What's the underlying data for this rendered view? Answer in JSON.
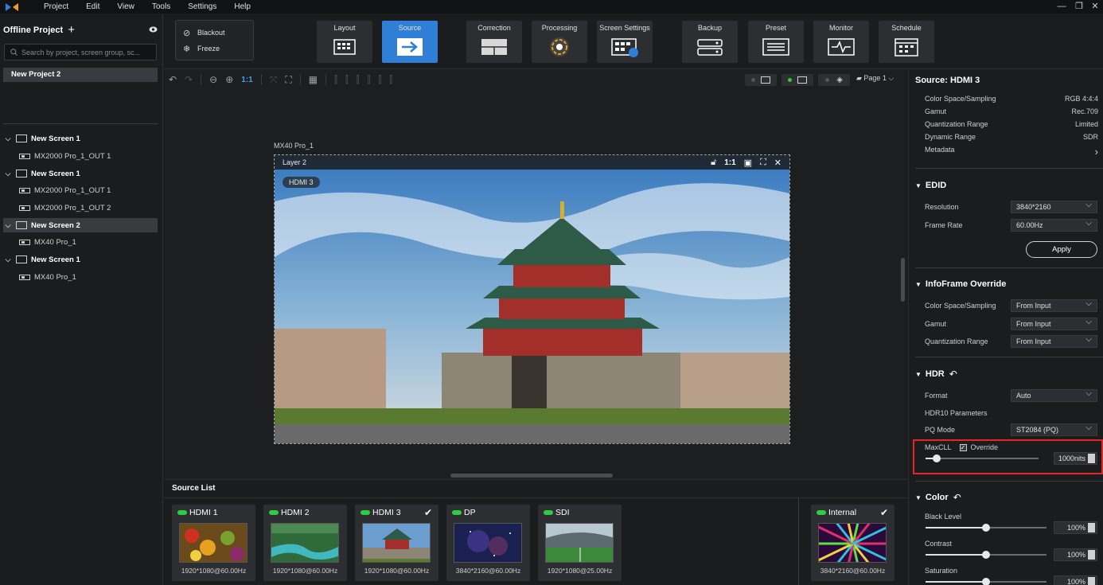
{
  "menubar": {
    "items": [
      "Project",
      "Edit",
      "View",
      "Tools",
      "Settings",
      "Help"
    ],
    "window_controls": [
      "—",
      "❐",
      "✕"
    ]
  },
  "left_panel": {
    "project_title": "Offline Project",
    "search_placeholder": "Search by project, screen group, sc...",
    "project_item": "New Project 2",
    "tree": [
      {
        "label": "New Screen 1",
        "type": "screen",
        "selected": false
      },
      {
        "label": "MX2000 Pro_1_OUT 1",
        "type": "device"
      },
      {
        "label": "New Screen 1",
        "type": "screen",
        "selected": false
      },
      {
        "label": "MX2000 Pro_1_OUT 1",
        "type": "device"
      },
      {
        "label": "MX2000 Pro_1_OUT 2",
        "type": "device"
      },
      {
        "label": "New Screen 2",
        "type": "screen",
        "selected": true
      },
      {
        "label": "MX40 Pro_1",
        "type": "device"
      },
      {
        "label": "New Screen 1",
        "type": "screen",
        "selected": false
      },
      {
        "label": "MX40 Pro_1",
        "type": "device"
      }
    ]
  },
  "toolbar": {
    "blackout": "Blackout",
    "freeze": "Freeze",
    "buttons": [
      "Layout",
      "Source",
      "Correction",
      "Processing",
      "Screen Settings",
      "Backup",
      "Preset",
      "Monitor",
      "Schedule"
    ],
    "active": "Source"
  },
  "canvas": {
    "zoom_label": "1:1",
    "page_label": "Page 1",
    "device_label": "MX40 Pro_1",
    "layer_label": "Layer 2",
    "layer_ratio": "1:1",
    "source_tag": "HDMI 3"
  },
  "source_list": {
    "title": "Source List",
    "sources": [
      {
        "name": "HDMI 1",
        "res": "1920*1080@60.00Hz",
        "checked": false
      },
      {
        "name": "HDMI 2",
        "res": "1920*1080@60.00Hz",
        "checked": false
      },
      {
        "name": "HDMI 3",
        "res": "1920*1080@60.00Hz",
        "checked": true
      },
      {
        "name": "DP",
        "res": "3840*2160@60.00Hz",
        "checked": false
      },
      {
        "name": "SDI",
        "res": "1920*1080@25.00Hz",
        "checked": false
      }
    ],
    "internal": {
      "name": "Internal",
      "res": "3840*2160@60.00Hz",
      "checked": true
    }
  },
  "right_panel": {
    "title": "Source: HDMI 3",
    "info": [
      {
        "k": "Color Space/Sampling",
        "v": "RGB 4:4:4"
      },
      {
        "k": "Gamut",
        "v": "Rec.709"
      },
      {
        "k": "Quantization Range",
        "v": "Limited"
      },
      {
        "k": "Dynamic Range",
        "v": "SDR"
      },
      {
        "k": "Metadata",
        "v": "›"
      }
    ],
    "edid": {
      "title": "EDID",
      "resolution_label": "Resolution",
      "resolution": "3840*2160",
      "frame_rate_label": "Frame Rate",
      "frame_rate": "60.00Hz",
      "apply": "Apply"
    },
    "infoframe": {
      "title": "InfoFrame Override",
      "rows": [
        {
          "k": "Color Space/Sampling",
          "v": "From Input"
        },
        {
          "k": "Gamut",
          "v": "From Input"
        },
        {
          "k": "Quantization Range",
          "v": "From Input"
        }
      ]
    },
    "hdr": {
      "title": "HDR",
      "format_label": "Format",
      "format": "Auto",
      "params_label": "HDR10 Parameters",
      "pq_label": "PQ Mode",
      "pq": "ST2084 (PQ)",
      "maxcll_label": "MaxCLL",
      "override_label": "Override",
      "maxcll_value": "1000nits",
      "maxcll_level": 0.1
    },
    "color": {
      "title": "Color",
      "rows": [
        {
          "k": "Black Level",
          "v": "100%",
          "level": 0.5
        },
        {
          "k": "Contrast",
          "v": "100%",
          "level": 0.5
        },
        {
          "k": "Saturation",
          "v": "100%",
          "level": 0.5
        }
      ]
    }
  },
  "colors": {
    "accent": "#2f7fd6",
    "led": "#2ecc40",
    "highlight": "#e3262a"
  }
}
